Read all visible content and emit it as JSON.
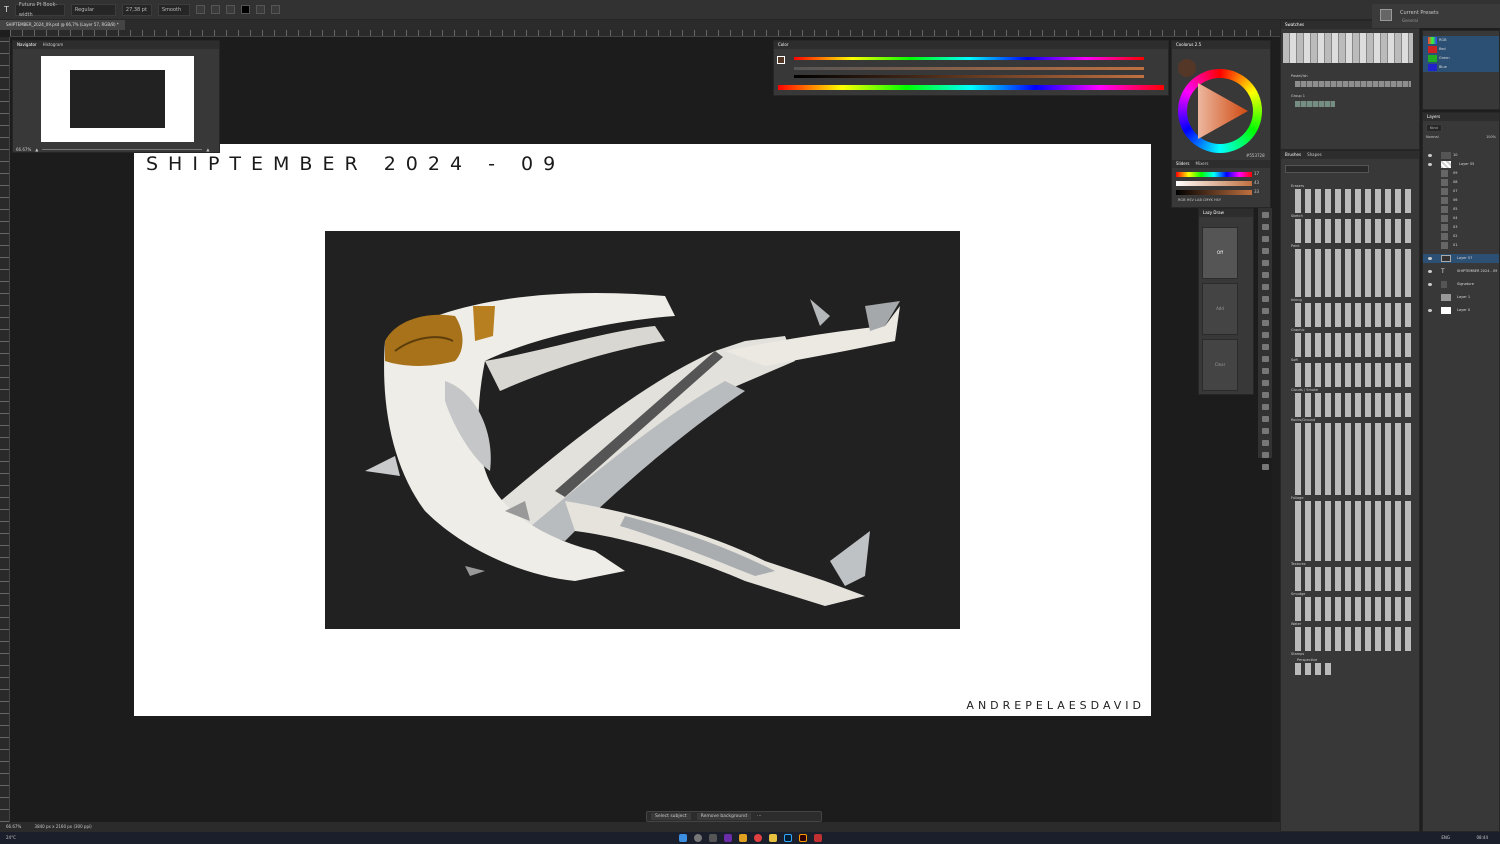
{
  "toolbar": {
    "font": "Futura Pt Book-width",
    "style": "Regular",
    "size": "27,38 pt",
    "anti_alias": "Smooth"
  },
  "document": {
    "tab_title": "SHIPTEMBER_2024_09.psd @ 66,7% (Layer 57, RGB/8) *"
  },
  "artwork": {
    "title": "SHIPTEMBER 2024 - 09",
    "signature": "ANDREPELAESDAVID",
    "render_bg": "#212121"
  },
  "navigator": {
    "tabs": [
      "Navigator",
      "Histogram"
    ],
    "zoom": "66.67%"
  },
  "color_panel": {
    "title": "Color"
  },
  "coolorus": {
    "title": "Coolorus 2.5",
    "hex": "#553728",
    "tabs": [
      "Sliders",
      "Mixers"
    ],
    "modes": "RGB HSV LAB CMYK HSY",
    "values": [
      "17",
      "43",
      "33"
    ]
  },
  "lazy_nezumi": {
    "title": "Lazy Draw",
    "buttons": [
      "Off",
      "Add",
      "Clear"
    ]
  },
  "properties": {
    "title": "Current Presets",
    "subtitle": "General"
  },
  "swatches": {
    "title": "Swatches",
    "groups": [
      "Pastel/ish",
      "Group 1"
    ]
  },
  "brushes": {
    "tabs": [
      "Brushes",
      "Shapes"
    ],
    "groups": [
      "Erasers",
      "Sketch",
      "Paint",
      "Inking",
      "Graphic",
      "Soft",
      "Clouds / Smoke",
      "Rocks/Ground",
      "Foliage",
      "Textures",
      "Smudge",
      "Water",
      "Stamps",
      "Perspective"
    ]
  },
  "channels": {
    "items": [
      "RGB",
      "Red",
      "Green",
      "Blue"
    ]
  },
  "layers": {
    "title": "Layers",
    "kind": "Kind",
    "blend": "Normal",
    "opacity": "100%",
    "items": [
      "10",
      "Layer 55",
      "09",
      "08",
      "07",
      "06",
      "05",
      "04",
      "03",
      "02",
      "01",
      "Layer 57",
      "SHIPTEMBER 2024 - 09",
      "Signature",
      "Layer 1",
      "Layer 0"
    ]
  },
  "status": {
    "zoom": "66.67%",
    "dims": "3840 px x 2160 px (300 ppi)"
  },
  "contextbar": {
    "select": "Select subject",
    "remove": "Remove background"
  },
  "taskbar": {
    "weather": "24°C",
    "lang": "ENG",
    "clock": "08:44"
  },
  "colors": {
    "accent": "#2c4f74",
    "bg": "#1c1c1c",
    "panel": "#383838"
  }
}
